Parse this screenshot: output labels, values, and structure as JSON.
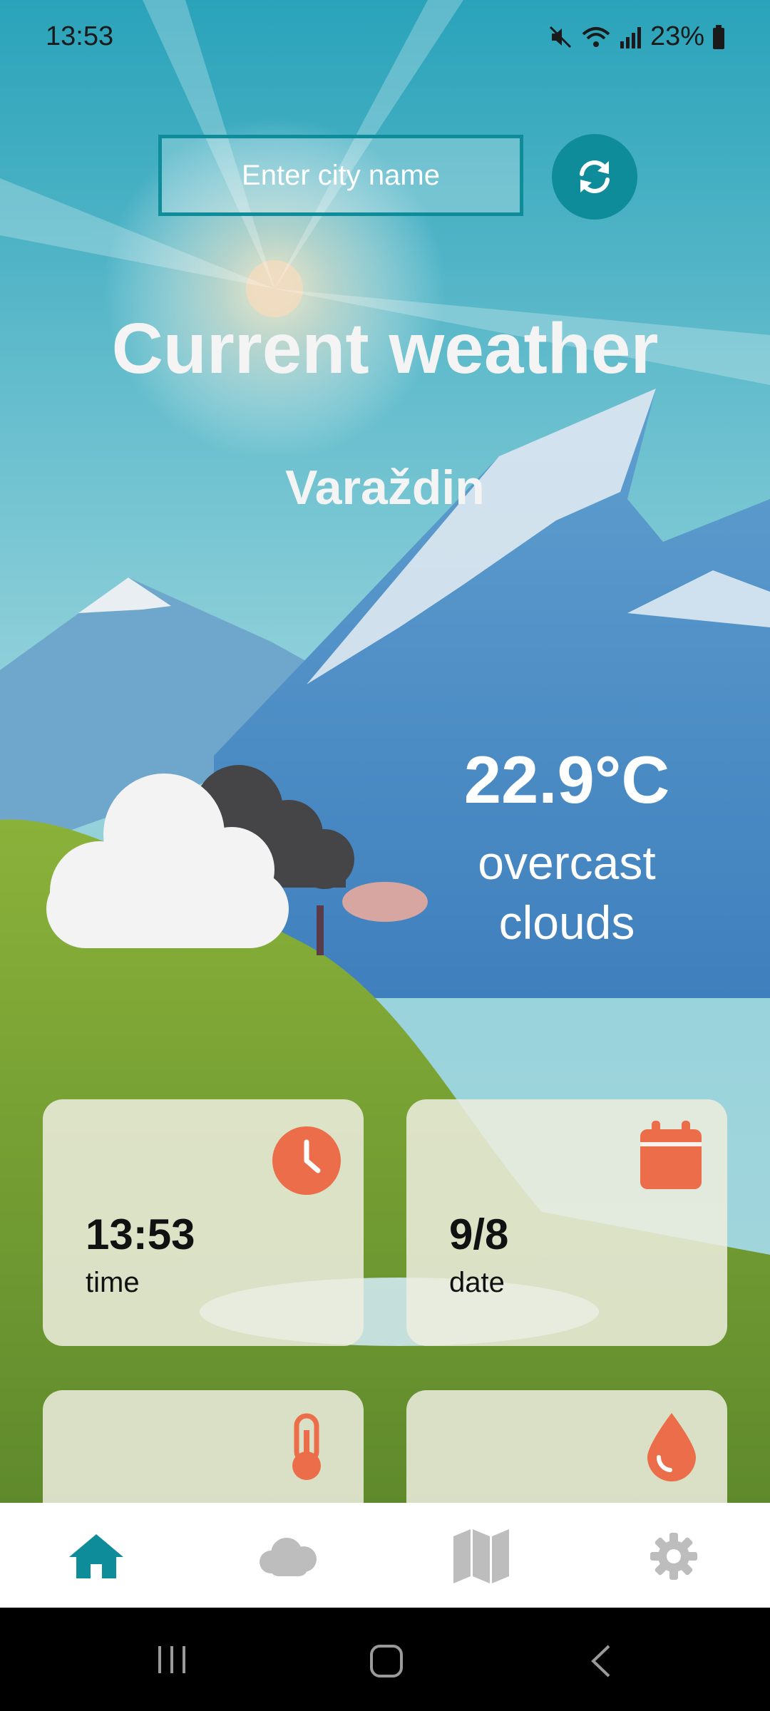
{
  "status_bar": {
    "time": "13:53",
    "battery": "23%"
  },
  "search": {
    "placeholder": "Enter city name",
    "value": ""
  },
  "header": {
    "title": "Current weather",
    "city": "Varaždin"
  },
  "current": {
    "temperature": "22.9°C",
    "condition_line1": "overcast",
    "condition_line2": "clouds",
    "icon": "overcast-clouds-icon"
  },
  "cards": [
    {
      "value": "13:53",
      "label": "time",
      "icon": "clock-icon"
    },
    {
      "value": "9/8",
      "label": "date",
      "icon": "calendar-icon"
    },
    {
      "value": "",
      "label": "",
      "icon": "thermometer-icon"
    },
    {
      "value": "",
      "label": "",
      "icon": "water-drop-icon"
    }
  ],
  "bottom_nav": [
    {
      "icon": "home-icon",
      "active": true
    },
    {
      "icon": "cloud-icon",
      "active": false
    },
    {
      "icon": "map-icon",
      "active": false
    },
    {
      "icon": "gear-icon",
      "active": false
    }
  ],
  "colors": {
    "accent": "#0f8c9a",
    "card_icon": "#ec6d4a",
    "nav_inactive": "#bdbdbd"
  }
}
